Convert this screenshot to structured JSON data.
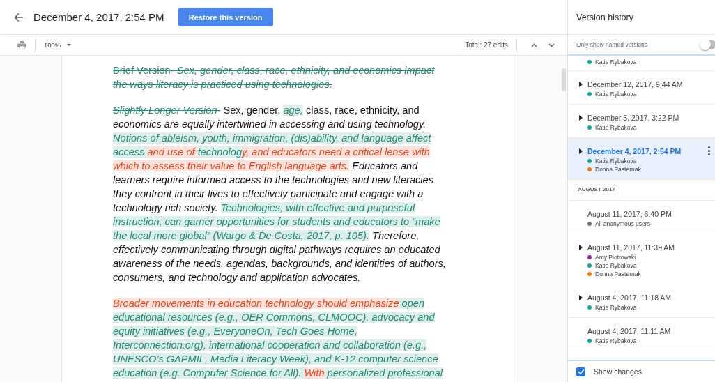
{
  "header": {
    "title": "December 4, 2017, 2:54 PM",
    "restore_button": "Restore this version"
  },
  "toolbar": {
    "zoom": "100%",
    "edit_count": "Total: 27 edits"
  },
  "document": {
    "paragraphs": [
      {
        "lines": [
          [
            {
              "text": "Brief Version-",
              "color": "#1f8a78",
              "deleted": true,
              "italic": false
            },
            {
              "text": " Sex, gender, class, race, ethnicity, and economics impact",
              "color": "#1f8a78",
              "deleted": true,
              "italic": true
            }
          ],
          [
            {
              "text": "the ways literacy is practiced using technologies.",
              "color": "#1f8a78",
              "deleted": true,
              "italic": true
            }
          ]
        ]
      },
      {
        "lines": [
          [
            {
              "text": "Slightly Longer Version-",
              "color": "#1f8a78",
              "deleted": true,
              "italic": true
            },
            {
              "text": " Sex, gender, ",
              "deleted": false,
              "italic": false
            },
            {
              "text": "age,",
              "color": "#1f8a78",
              "deleted": false,
              "italic": true
            },
            {
              "text": " class, race, ethnicity, and",
              "deleted": false,
              "italic": false
            }
          ],
          [
            {
              "text": "economics are equally intertwined in accessing and using technology.",
              "deleted": false,
              "italic": true
            }
          ],
          [
            {
              "text": "Notions of ableism, youth, immigration, (dis)ability, and language affect",
              "color": "#1f8a78",
              "deleted": false,
              "italic": true
            }
          ],
          [
            {
              "text": "access ",
              "color": "#1f8a78",
              "deleted": false,
              "italic": true
            },
            {
              "text": "and use of ",
              "color": "#e8461e",
              "deleted": false,
              "italic": true
            },
            {
              "text": "technolog",
              "color": "#1f8a78",
              "deleted": false,
              "italic": true
            },
            {
              "text": "y, and educators need a critical lense with",
              "color": "#e8461e",
              "deleted": false,
              "italic": true
            }
          ],
          [
            {
              "text": "which to assess their value to English language arts.",
              "color": "#e8461e",
              "deleted": false,
              "italic": true
            },
            {
              "text": " Educators and",
              "deleted": false,
              "italic": true
            }
          ],
          [
            {
              "text": "learners require informed access to the technologies and new literacies",
              "deleted": false,
              "italic": true
            }
          ],
          [
            {
              "text": "they confront in their lives to effectively participate and engage with a",
              "deleted": false,
              "italic": true
            }
          ],
          [
            {
              "text": "technology rich society. ",
              "deleted": false,
              "italic": true
            },
            {
              "text": "Technologies, with effective and purposeful",
              "color": "#1f8a78",
              "deleted": false,
              "italic": true
            }
          ],
          [
            {
              "text": "instruction, can garner opportunities for students and educators to “make",
              "color": "#1f8a78",
              "deleted": false,
              "italic": true
            }
          ],
          [
            {
              "text": "the local more global” (Wargo & De Costa, 2017, p. 105).",
              "color": "#1f8a78",
              "deleted": false,
              "italic": true
            },
            {
              "text": " Therefore,",
              "deleted": false,
              "italic": true
            }
          ],
          [
            {
              "text": "effectively communicating through digital pathways requires an educated",
              "deleted": false,
              "italic": true
            }
          ],
          [
            {
              "text": "awareness of the needs, agendas, backgrounds, and identities of authors,",
              "deleted": false,
              "italic": true
            }
          ],
          [
            {
              "text": "consumers, and technology and application advocates.",
              "deleted": false,
              "italic": true
            }
          ]
        ]
      },
      {
        "lines": [
          [
            {
              "text": "Broader movements in education technology should emphasize",
              "color": "#e8461e",
              "deleted": false,
              "italic": true
            },
            {
              "text": " open",
              "color": "#1f8a78",
              "deleted": false,
              "italic": true
            }
          ],
          [
            {
              "text": "educational resources (e.g., OER Commons, CLMOOC), advocacy and",
              "color": "#1f8a78",
              "deleted": false,
              "italic": true
            }
          ],
          [
            {
              "text": "equity initiatives (e.g., EveryoneOn, Tech Goes Home,",
              "color": "#1f8a78",
              "deleted": false,
              "italic": true
            }
          ],
          [
            {
              "text": "Interconnection.org), international cooperation and collaboration (e.g.,",
              "color": "#1f8a78",
              "deleted": false,
              "italic": true
            }
          ],
          [
            {
              "text": "UNESCO’s GAPMIL, Media Literacy Week), and K-12 computer science",
              "color": "#1f8a78",
              "deleted": false,
              "italic": true
            }
          ],
          [
            {
              "text": "education (e.g. Computer Science for All). ",
              "color": "#1f8a78",
              "deleted": false,
              "italic": true
            },
            {
              "text": "With",
              "color": "#e8461e",
              "deleted": false,
              "italic": true
            },
            {
              "text": " personalized professional",
              "color": "#1f8a78",
              "deleted": false,
              "italic": true
            }
          ]
        ]
      }
    ]
  },
  "version_history": {
    "title": "Version history",
    "named_only": {
      "label": "Only show named versions",
      "on": false
    },
    "entries": [
      {
        "kind": "version",
        "selected": false,
        "authors": [
          {
            "name": "Katie Rybakova",
            "color": "#12a58f"
          }
        ]
      },
      {
        "kind": "version",
        "date": "December 12, 2017, 9:44 AM",
        "expandable": true,
        "selected": false,
        "authors": [
          {
            "name": "Katie Rybakova",
            "color": "#12a58f"
          }
        ]
      },
      {
        "kind": "version",
        "date": "December 5, 2017, 3:22 PM",
        "expandable": true,
        "selected": false,
        "authors": [
          {
            "name": "Katie Rybakova",
            "color": "#12a58f"
          }
        ]
      },
      {
        "kind": "version",
        "date": "December 4, 2017, 2:54 PM",
        "expandable": true,
        "selected": true,
        "authors": [
          {
            "name": "Katie Rybakova",
            "color": "#12a58f"
          },
          {
            "name": "Donna Pasternak",
            "color": "#f57c00"
          }
        ]
      },
      {
        "kind": "group_header",
        "label": "AUGUST 2017"
      },
      {
        "kind": "version",
        "date": "August 11, 2017, 6:40 PM",
        "expandable": false,
        "selected": false,
        "authors": [
          {
            "name": "All anonymous users",
            "color": "#757575"
          }
        ]
      },
      {
        "kind": "version",
        "date": "August 11, 2017, 11:39 AM",
        "expandable": true,
        "selected": false,
        "authors": [
          {
            "name": "Amy Piotrowski",
            "color": "#8e24aa"
          },
          {
            "name": "Katie Rybakova",
            "color": "#12a58f"
          },
          {
            "name": "Donna Pasternak",
            "color": "#f57c00"
          }
        ]
      },
      {
        "kind": "version",
        "date": "August 4, 2017, 11:18 AM",
        "expandable": true,
        "selected": false,
        "authors": [
          {
            "name": "Katie Rybakova",
            "color": "#12a58f"
          }
        ]
      },
      {
        "kind": "version",
        "date": "August 4, 2017, 11:11 AM",
        "expandable": false,
        "selected": false,
        "authors": [
          {
            "name": "Katie Rybakova",
            "color": "#12a58f"
          }
        ]
      }
    ],
    "show_changes": {
      "label": "Show changes",
      "checked": true
    }
  }
}
